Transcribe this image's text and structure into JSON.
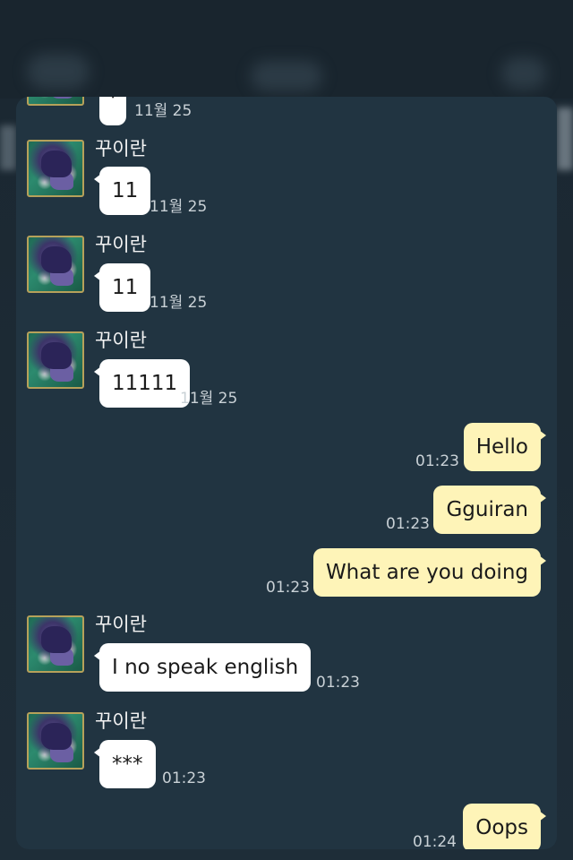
{
  "colors": {
    "background": "#1e2d38",
    "panel": "#213441",
    "incoming_bubble": "#ffffff",
    "outgoing_bubble": "#fef4b8",
    "timestamp": "#c9d1d6",
    "avatar_border": "#b6a15a"
  },
  "icons": {
    "avatar": "wolf-avatar-icon"
  },
  "partial_top": {
    "bubble_text": "'",
    "time": "11월 25"
  },
  "messages": [
    {
      "sender": "꾸이란",
      "text": "11",
      "time": "11월 25"
    },
    {
      "sender": "꾸이란",
      "text": "11",
      "time": "11월 25"
    },
    {
      "sender": "꾸이란",
      "text": "11111",
      "time": "11월 25"
    },
    {
      "text": "Hello",
      "time": "01:23"
    },
    {
      "text": "Gguiran",
      "time": "01:23"
    },
    {
      "text": "What are you doing",
      "time": "01:23"
    },
    {
      "sender": "꾸이란",
      "text": "I no speak english",
      "time": "01:23"
    },
    {
      "sender": "꾸이란",
      "text": "***",
      "time": "01:23"
    },
    {
      "text": "Oops",
      "time": "01:24"
    }
  ]
}
